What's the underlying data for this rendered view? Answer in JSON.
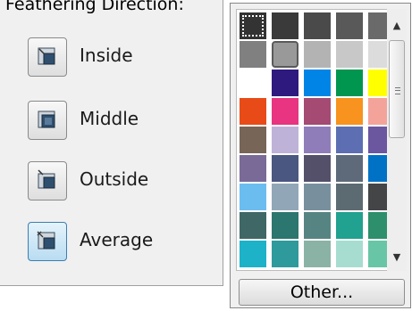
{
  "panel": {
    "title": "Feathering Direction:",
    "options": [
      {
        "label": "Inside",
        "icon": "feather-inside-icon",
        "active": false
      },
      {
        "label": "Middle",
        "icon": "feather-middle-icon",
        "active": false
      },
      {
        "label": "Outside",
        "icon": "feather-outside-icon",
        "active": false
      },
      {
        "label": "Average",
        "icon": "feather-average-icon",
        "active": true
      }
    ]
  },
  "palette": {
    "selected": "#333333",
    "rows": [
      [
        "#333333",
        "#3a3a3a",
        "#4a4a4a",
        "#595959",
        "#6a6a6a"
      ],
      [
        "#808080",
        "#999999",
        "#b3b3b3",
        "#c8c8c8",
        "#dcdcdc"
      ],
      [
        "#ffffff",
        "#2e1a7f",
        "#0085e6",
        "#00964f",
        "#ffff00"
      ],
      [
        "#e84b17",
        "#e83481",
        "#a44a73",
        "#f7931e",
        "#f4a39b"
      ],
      [
        "#776557",
        "#bfb2d8",
        "#8f7dba",
        "#5d6fb2",
        "#6b56a0"
      ],
      [
        "#7a6a97",
        "#4a5780",
        "#54506a",
        "#5e6a7a",
        "#0072c6"
      ],
      [
        "#6bbdf0",
        "#91a7b7",
        "#78909e",
        "#5c6b71",
        "#434547"
      ],
      [
        "#3f6766",
        "#2b766f",
        "#568483",
        "#21a18f",
        "#2d8f6b"
      ],
      [
        "#1db2c8",
        "#2f9a9c",
        "#8bb3a5",
        "#a6ddd0",
        "#68c5a6"
      ]
    ]
  },
  "buttons": {
    "other_label": "Other..."
  },
  "scrollbar": {
    "up_icon": "scroll-up-icon",
    "down_icon": "scroll-down-icon"
  }
}
